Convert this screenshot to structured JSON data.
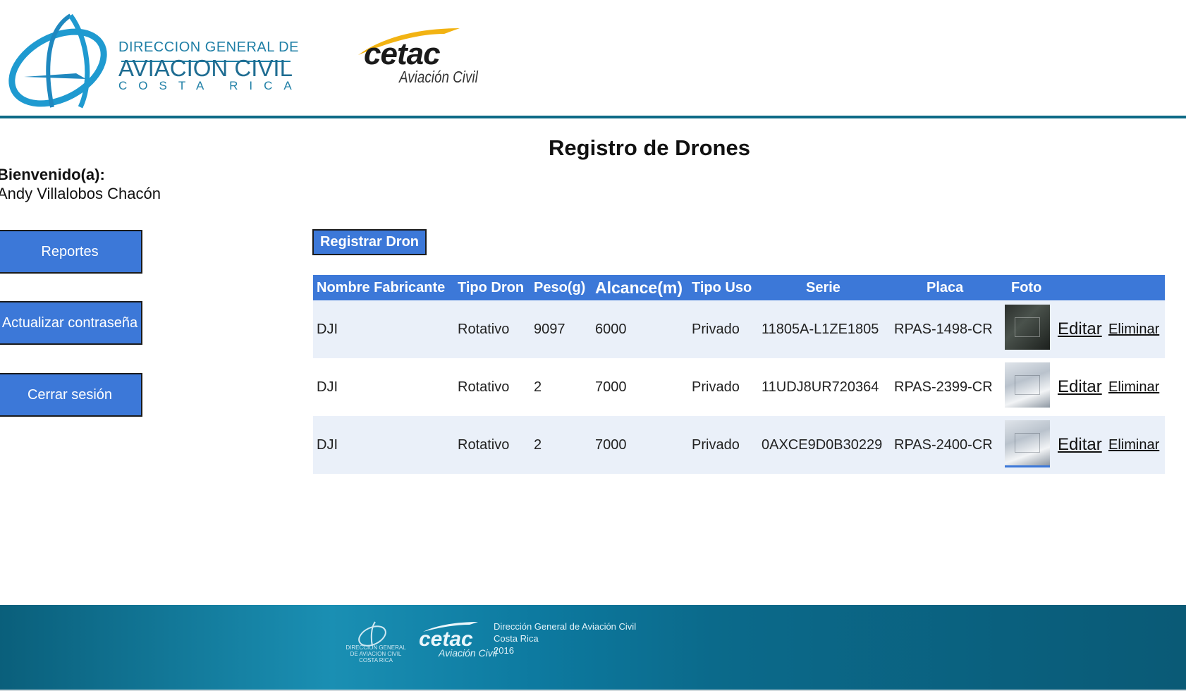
{
  "header": {
    "dgac_logo": {
      "line1": "DIRECCION GENERAL DE",
      "line2": "AVIACION CIVIL",
      "line3": "COSTA RICA"
    },
    "cetac_logo": {
      "word": "cetac",
      "sub": "Aviación Civil"
    }
  },
  "page": {
    "title": "Registro de Drones"
  },
  "welcome": {
    "label": "Bienvenido(a):",
    "name": "Andy Villalobos Chacón"
  },
  "sidebar": {
    "buttons": [
      {
        "label": "Reportes"
      },
      {
        "label": "Actualizar contraseña"
      },
      {
        "label": "Cerrar sesión"
      }
    ]
  },
  "actions": {
    "register_label": "Registrar Dron"
  },
  "table": {
    "headers": [
      "Nombre Fabricante",
      "Tipo Dron",
      "Peso(g)",
      "Alcance(m)",
      "Tipo Uso",
      "Serie",
      "Placa",
      "Foto"
    ],
    "rows": [
      {
        "fabricante": "DJI",
        "tipo": "Rotativo",
        "peso": "9097",
        "alcance": "6000",
        "uso": "Privado",
        "serie": "11805A-L1ZE1805",
        "placa": "RPAS-1498-CR",
        "foto": "photo-thumbnail-dark",
        "edit": "Editar",
        "delete": "Eliminar"
      },
      {
        "fabricante": "DJI",
        "tipo": "Rotativo",
        "peso": "2",
        "alcance": "7000",
        "uso": "Privado",
        "serie": "11UDJ8UR720364",
        "placa": "RPAS-2399-CR",
        "foto": "photo-thumbnail-light",
        "edit": "Editar",
        "delete": "Eliminar"
      },
      {
        "fabricante": "DJI",
        "tipo": "Rotativo",
        "peso": "2",
        "alcance": "7000",
        "uso": "Privado",
        "serie": "0AXCE9D0B30229",
        "placa": "RPAS-2400-CR",
        "foto": "photo-thumbnail-light",
        "edit": "Editar",
        "delete": "Eliminar"
      }
    ]
  },
  "footer": {
    "dgac_small": "DIRECCION GENERAL DE AVIACION CIVIL COSTA RICA",
    "cetac_word": "cetac",
    "cetac_sub": "Aviación Civil",
    "line1": "Dirección General de Aviación Civil",
    "line2": "Costa Rica",
    "line3": "2016"
  },
  "colors": {
    "accent_blue": "#3c78d8",
    "header_rule": "#0e6a86",
    "row_tint": "#eaf0f9",
    "footer_teal": "#0d7aa0",
    "logo_blue": "#1f7fa6"
  }
}
